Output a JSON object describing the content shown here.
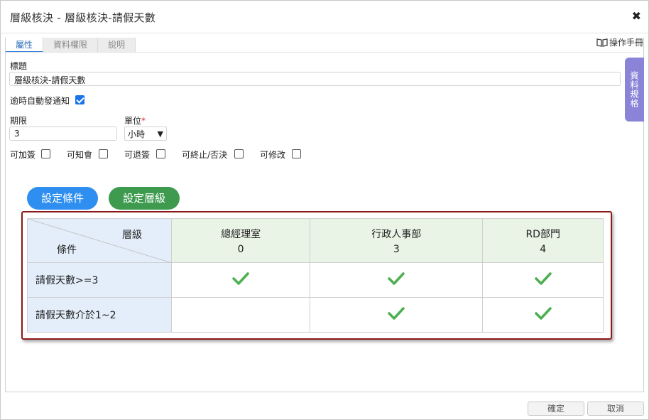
{
  "dialog": {
    "title": "層級核決 - 層級核決-請假天數",
    "close_glyph": "✖"
  },
  "tabs": [
    {
      "label": "屬性",
      "active": true
    },
    {
      "label": "資料權限",
      "active": false
    },
    {
      "label": "說明",
      "active": false
    }
  ],
  "manual_link": "操作手冊",
  "side_tab": "資料規格",
  "form": {
    "title_label": "標題",
    "title_value": "層級核決-請假天數",
    "auto_notify_label": "逾時自動發通知",
    "auto_notify_checked": true,
    "deadline_label": "期限",
    "deadline_value": "3",
    "unit_label": "單位",
    "unit_required": "*",
    "unit_value": "小時",
    "options": [
      {
        "label": "可加簽",
        "checked": false
      },
      {
        "label": "可知會",
        "checked": false
      },
      {
        "label": "可退簽",
        "checked": false
      },
      {
        "label": "可終止/否決",
        "checked": false
      },
      {
        "label": "可修改",
        "checked": false
      }
    ]
  },
  "buttons": {
    "set_condition": "設定條件",
    "set_level": "設定層級",
    "confirm": "確定",
    "cancel": "取消"
  },
  "matrix": {
    "corner_top": "層級",
    "corner_bottom": "條件",
    "columns": [
      {
        "name": "總經理室",
        "level": "0"
      },
      {
        "name": "行政人事部",
        "level": "3"
      },
      {
        "name": "RD部門",
        "level": "4"
      }
    ],
    "rows": [
      {
        "condition": "請假天數>=3",
        "checks": [
          true,
          true,
          true
        ]
      },
      {
        "condition": "請假天數介於1~2",
        "checks": [
          false,
          true,
          true
        ]
      }
    ]
  },
  "colors": {
    "blue_button": "#2e8ff0",
    "green_button": "#3d9a4f",
    "frame_border": "#8b1a1a",
    "check_green": "#4caf50",
    "side_tab": "#8a84d8"
  }
}
